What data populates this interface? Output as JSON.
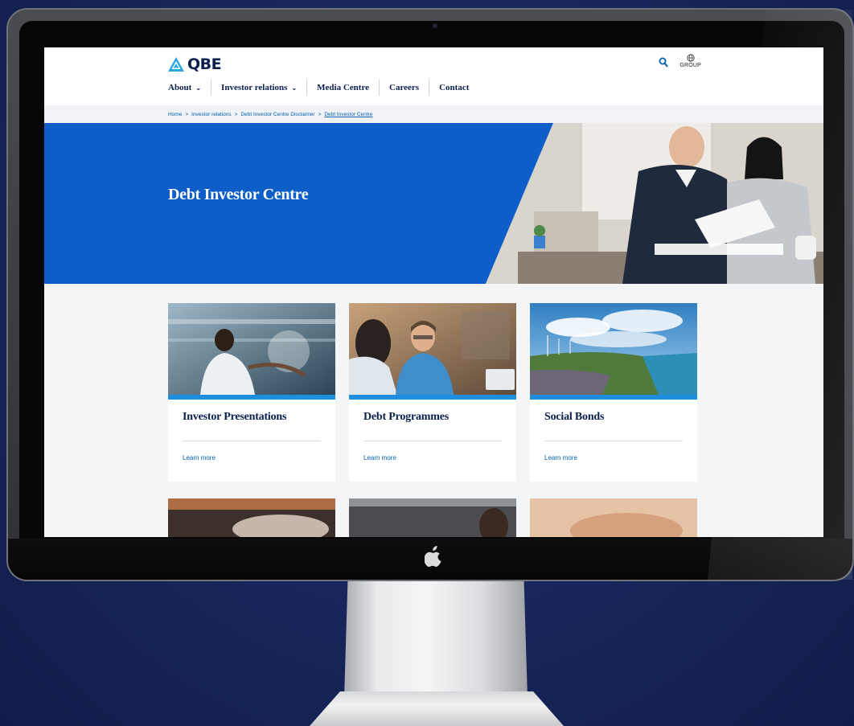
{
  "site": {
    "logo_text": "QBE",
    "group_label": "GROUP",
    "brand_color": "#0e5ec9",
    "accent_color": "#1e8fe0",
    "navy_color": "#0a1f4d"
  },
  "nav": {
    "items": [
      {
        "label": "About",
        "has_dropdown": true
      },
      {
        "label": "Investor relations",
        "has_dropdown": true
      },
      {
        "label": "Media Centre",
        "has_dropdown": false
      },
      {
        "label": "Careers",
        "has_dropdown": false
      },
      {
        "label": "Contact",
        "has_dropdown": false
      }
    ]
  },
  "breadcrumb": {
    "items": [
      "Home",
      "Investor relations",
      "Debt Investor Centre Disclaimer",
      "Debt Investor Centre"
    ],
    "separator": ">"
  },
  "hero": {
    "title": "Debt Investor Centre"
  },
  "cards": [
    {
      "title": "Investor Presentations",
      "link": "Learn more",
      "image": "presenter-photo"
    },
    {
      "title": "Debt Programmes",
      "link": "Learn more",
      "image": "meeting-photo"
    },
    {
      "title": "Social Bonds",
      "link": "Learn more",
      "image": "coastline-windfarm-photo"
    }
  ],
  "icons": {
    "search": "search-icon",
    "globe": "globe-icon",
    "chevron": "chevron-down-icon",
    "apple": "apple-logo-icon"
  }
}
